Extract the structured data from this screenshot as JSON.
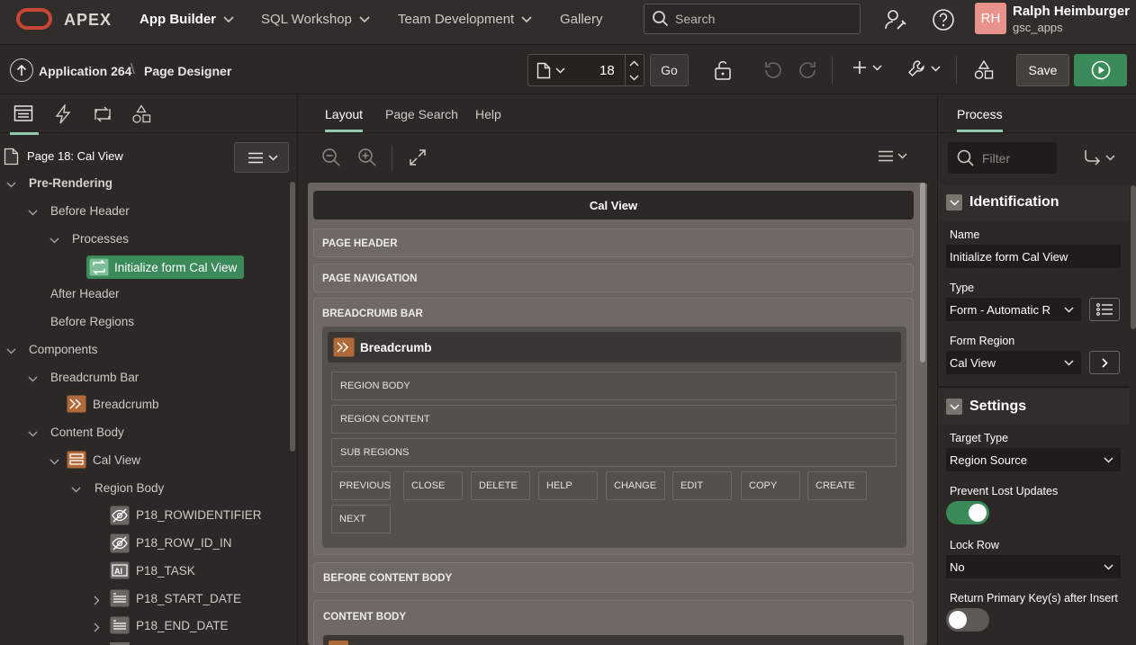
{
  "topnav": {
    "logo_text": "APEX",
    "items": [
      {
        "label": "App Builder"
      },
      {
        "label": "SQL Workshop"
      },
      {
        "label": "Team Development"
      },
      {
        "label": "Gallery"
      }
    ],
    "search_placeholder": "Search",
    "user": {
      "initials": "RH",
      "name": "Ralph Heimburger",
      "workspace": "gsc_apps"
    }
  },
  "toolbar": {
    "breadcrumb_app": "Application 264",
    "breadcrumb_page": "Page Designer",
    "page_number": "18",
    "go_label": "Go",
    "save_label": "Save"
  },
  "left": {
    "page_title": "Page 18: Cal View",
    "tree": {
      "pre_rendering": "Pre-Rendering",
      "before_header": "Before Header",
      "processes": "Processes",
      "selected_process": "Initialize form Cal View",
      "after_header": "After Header",
      "before_regions": "Before Regions",
      "components": "Components",
      "breadcrumb_bar": "Breadcrumb Bar",
      "breadcrumb": "Breadcrumb",
      "content_body": "Content Body",
      "cal_view": "Cal View",
      "region_body": "Region Body",
      "items": [
        "P18_ROWIDENTIFIER",
        "P18_ROW_ID_IN",
        "P18_TASK",
        "P18_START_DATE",
        "P18_END_DATE"
      ]
    }
  },
  "center": {
    "tabs": [
      {
        "label": "Layout"
      },
      {
        "label": "Page Search"
      },
      {
        "label": "Help"
      }
    ],
    "canvas_title": "Cal View",
    "slots": {
      "page_header": "PAGE HEADER",
      "page_navigation": "PAGE NAVIGATION",
      "breadcrumb_bar": "BREADCRUMB BAR",
      "before_content_body": "BEFORE CONTENT BODY",
      "content_body": "CONTENT BODY"
    },
    "region": {
      "title": "Breadcrumb",
      "slots": [
        "REGION BODY",
        "REGION CONTENT",
        "SUB REGIONS"
      ],
      "buttons": [
        "PREVIOUS",
        "CLOSE",
        "DELETE",
        "HELP",
        "CHANGE",
        "EDIT",
        "COPY",
        "CREATE",
        "NEXT"
      ]
    }
  },
  "right": {
    "tab_label": "Process",
    "filter_placeholder": "Filter",
    "groups": {
      "identification": "Identification",
      "settings": "Settings"
    },
    "props": {
      "name_label": "Name",
      "name_value": "Initialize form Cal View",
      "type_label": "Type",
      "type_value": "Form - Automatic R",
      "form_region_label": "Form Region",
      "form_region_value": "Cal View",
      "target_type_label": "Target Type",
      "target_type_value": "Region Source",
      "prevent_lost_label": "Prevent Lost Updates",
      "prevent_lost_on": true,
      "lock_row_label": "Lock Row",
      "lock_row_value": "No",
      "return_pk_label": "Return Primary Key(s) after Insert",
      "return_pk_on": false
    }
  },
  "colors": {
    "accent_green": "#3b8a5a",
    "brand_red": "#c74634",
    "tab_underline": "#8fc9a9"
  }
}
